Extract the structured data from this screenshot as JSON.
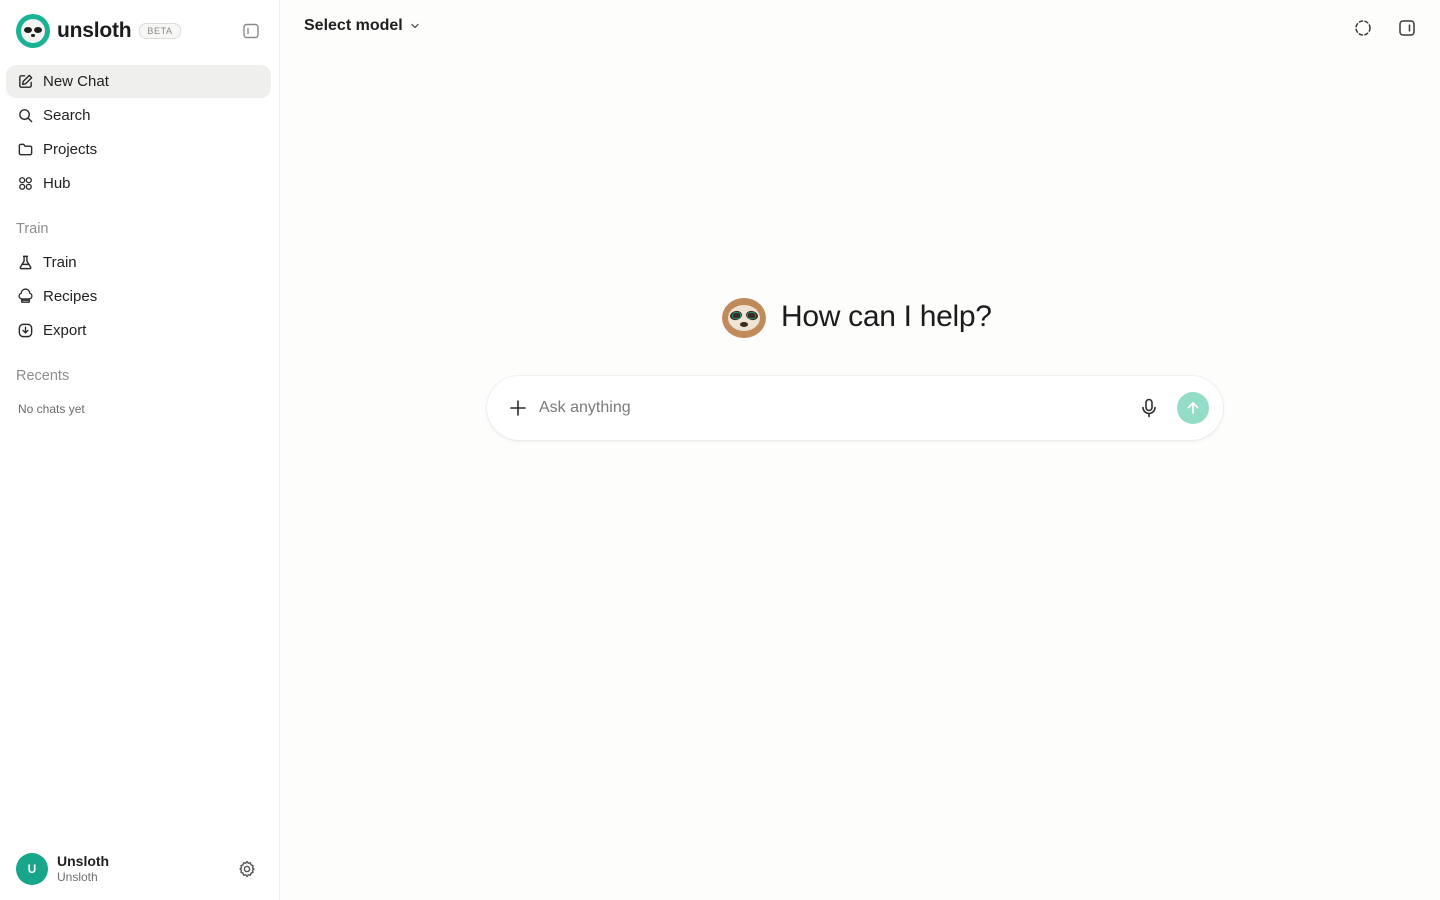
{
  "brand": {
    "name": "unsloth",
    "badge": "BETA"
  },
  "sidebar": {
    "items": [
      {
        "label": "New Chat",
        "icon": "edit-icon",
        "active": true
      },
      {
        "label": "Search",
        "icon": "search-icon",
        "active": false
      },
      {
        "label": "Projects",
        "icon": "folder-icon",
        "active": false
      },
      {
        "label": "Hub",
        "icon": "grid-icon",
        "active": false
      }
    ],
    "train_section": {
      "label": "Train",
      "items": [
        {
          "label": "Train",
          "icon": "flask-icon"
        },
        {
          "label": "Recipes",
          "icon": "chef-hat-icon"
        },
        {
          "label": "Export",
          "icon": "download-circle-icon"
        }
      ]
    },
    "recents": {
      "label": "Recents",
      "empty_text": "No chats yet"
    },
    "user": {
      "initial": "U",
      "name": "Unsloth",
      "subtitle": "Unsloth"
    }
  },
  "header": {
    "model_selector": "Select model"
  },
  "main": {
    "greeting": "How can I help?",
    "composer": {
      "placeholder": "Ask anything"
    }
  },
  "colors": {
    "accent": "#19b394",
    "send_button": "#93dcc7",
    "active_item_bg": "#efefed"
  }
}
